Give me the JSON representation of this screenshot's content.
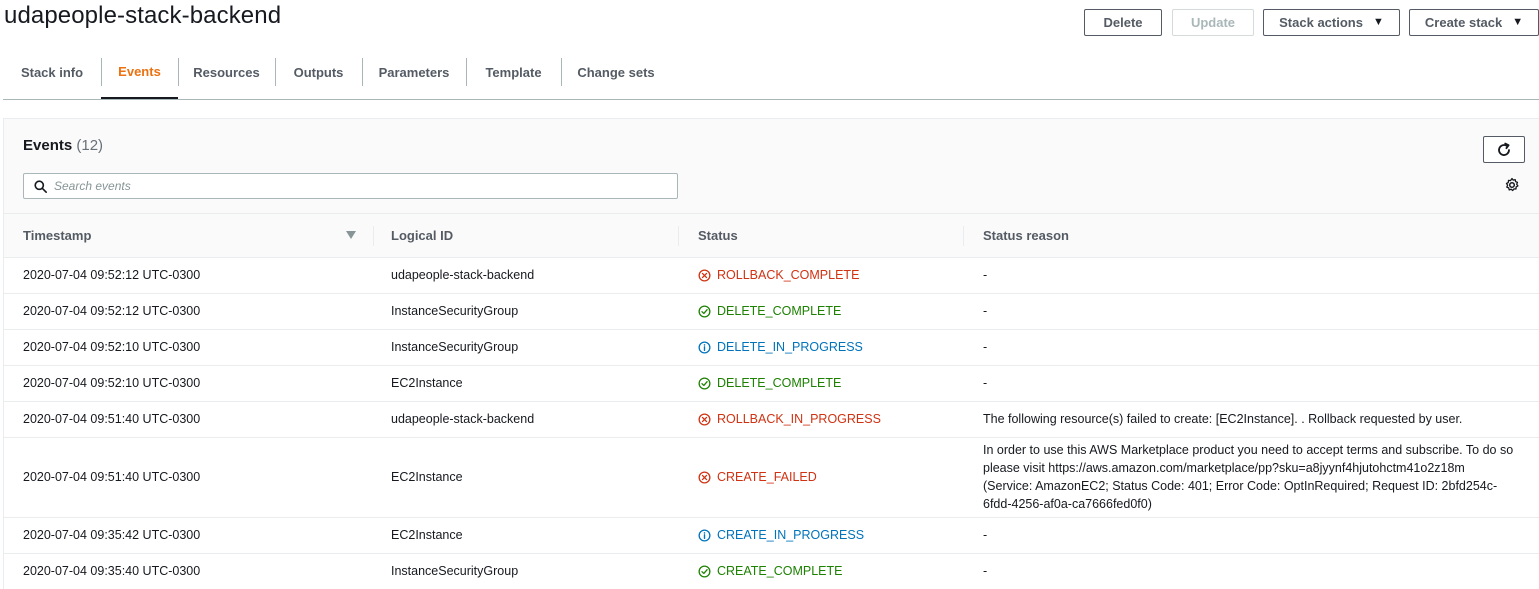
{
  "stack": {
    "title": "udapeople-stack-backend"
  },
  "actions": {
    "delete": "Delete",
    "update": "Update",
    "stack_actions": "Stack actions",
    "create_stack": "Create stack",
    "caret": "▼"
  },
  "tabs": [
    {
      "label": "Stack info"
    },
    {
      "label": "Events"
    },
    {
      "label": "Resources"
    },
    {
      "label": "Outputs"
    },
    {
      "label": "Parameters"
    },
    {
      "label": "Template"
    },
    {
      "label": "Change sets"
    }
  ],
  "active_tab": "Events",
  "events": {
    "heading": "Events",
    "count": "(12)",
    "search_placeholder": "Search events",
    "columns": [
      "Timestamp",
      "Logical ID",
      "Status",
      "Status reason"
    ],
    "rows": [
      {
        "timestamp": "2020-07-04 09:52:12 UTC-0300",
        "logical_id": "udapeople-stack-backend",
        "status": "ROLLBACK_COMPLETE",
        "status_type": "error",
        "reason": "-"
      },
      {
        "timestamp": "2020-07-04 09:52:12 UTC-0300",
        "logical_id": "InstanceSecurityGroup",
        "status": "DELETE_COMPLETE",
        "status_type": "success",
        "reason": "-"
      },
      {
        "timestamp": "2020-07-04 09:52:10 UTC-0300",
        "logical_id": "InstanceSecurityGroup",
        "status": "DELETE_IN_PROGRESS",
        "status_type": "info",
        "reason": "-"
      },
      {
        "timestamp": "2020-07-04 09:52:10 UTC-0300",
        "logical_id": "EC2Instance",
        "status": "DELETE_COMPLETE",
        "status_type": "success",
        "reason": "-"
      },
      {
        "timestamp": "2020-07-04 09:51:40 UTC-0300",
        "logical_id": "udapeople-stack-backend",
        "status": "ROLLBACK_IN_PROGRESS",
        "status_type": "error",
        "reason": "The following resource(s) failed to create: [EC2Instance]. . Rollback requested by user."
      },
      {
        "timestamp": "2020-07-04 09:51:40 UTC-0300",
        "logical_id": "EC2Instance",
        "status": "CREATE_FAILED",
        "status_type": "error",
        "reason": "In order to use this AWS Marketplace product you need to accept terms and subscribe. To do so please visit https://aws.amazon.com/marketplace/pp?sku=a8jyynf4hjutohctm41o2z18m (Service: AmazonEC2; Status Code: 401; Error Code: OptInRequired; Request ID: 2bfd254c-6fdd-4256-af0a-ca7666fed0f0)"
      },
      {
        "timestamp": "2020-07-04 09:35:42 UTC-0300",
        "logical_id": "EC2Instance",
        "status": "CREATE_IN_PROGRESS",
        "status_type": "info",
        "reason": "-"
      },
      {
        "timestamp": "2020-07-04 09:35:40 UTC-0300",
        "logical_id": "InstanceSecurityGroup",
        "status": "CREATE_COMPLETE",
        "status_type": "success",
        "reason": "-"
      }
    ]
  },
  "icons": {
    "search": "search-icon",
    "refresh": "refresh-icon",
    "settings": "gear-icon",
    "sort": "sort-down-icon",
    "error": "error-circle-icon",
    "success": "check-circle-icon",
    "info": "info-circle-icon"
  },
  "colors": {
    "accent": "#ec7211",
    "error": "#d13212",
    "success": "#1d8102",
    "info": "#0073bb"
  }
}
